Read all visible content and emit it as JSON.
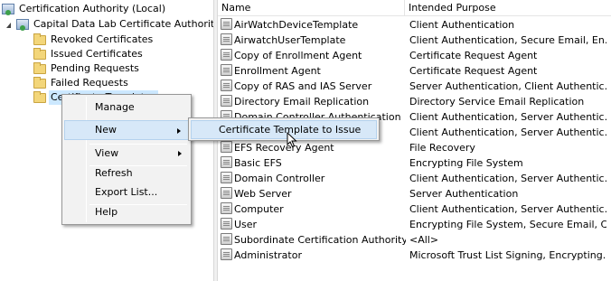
{
  "tree": {
    "items": [
      {
        "label": "Certification Authority (Local)"
      },
      {
        "label": "Capital Data Lab Certificate Authority"
      },
      {
        "label": "Revoked Certificates"
      },
      {
        "label": "Issued Certificates"
      },
      {
        "label": "Pending Requests"
      },
      {
        "label": "Failed Requests"
      },
      {
        "label": "Certificate Templates"
      }
    ]
  },
  "list": {
    "columns": [
      "Name",
      "Intended Purpose"
    ],
    "rows": [
      {
        "name": "AirWatchDeviceTemplate",
        "purpose": "Client Authentication"
      },
      {
        "name": "AirwatchUserTemplate",
        "purpose": "Client Authentication, Secure Email, En..."
      },
      {
        "name": "Copy of Enrollment Agent",
        "purpose": "Certificate Request Agent"
      },
      {
        "name": "Enrollment Agent",
        "purpose": "Certificate Request Agent"
      },
      {
        "name": "Copy of RAS and IAS Server",
        "purpose": "Server Authentication, Client Authentic..."
      },
      {
        "name": "Directory Email Replication",
        "purpose": "Directory Service Email Replication"
      },
      {
        "name": "Domain Controller Authentication",
        "purpose": "Client Authentication, Server Authentic..."
      },
      {
        "name": "",
        "purpose": "Client Authentication, Server Authentic..."
      },
      {
        "name": "EFS Recovery Agent",
        "purpose": "File Recovery"
      },
      {
        "name": "Basic EFS",
        "purpose": "Encrypting File System"
      },
      {
        "name": "Domain Controller",
        "purpose": "Client Authentication, Server Authentic..."
      },
      {
        "name": "Web Server",
        "purpose": "Server Authentication"
      },
      {
        "name": "Computer",
        "purpose": "Client Authentication, Server Authentic..."
      },
      {
        "name": "User",
        "purpose": "Encrypting File System, Secure Email, Cl..."
      },
      {
        "name": "Subordinate Certification Authority",
        "purpose": "<All>"
      },
      {
        "name": "Administrator",
        "purpose": "Microsoft Trust List Signing, Encrypting..."
      }
    ]
  },
  "context_menu": {
    "manage": "Manage",
    "new": "New",
    "view": "View",
    "refresh": "Refresh",
    "export_list": "Export List...",
    "help": "Help"
  },
  "submenu": {
    "item": "Certificate Template to Issue"
  },
  "colors": {
    "selection": "#cce8ff",
    "menu_highlight": "#d7e8f8",
    "menu_bg": "#f2f2f2"
  }
}
